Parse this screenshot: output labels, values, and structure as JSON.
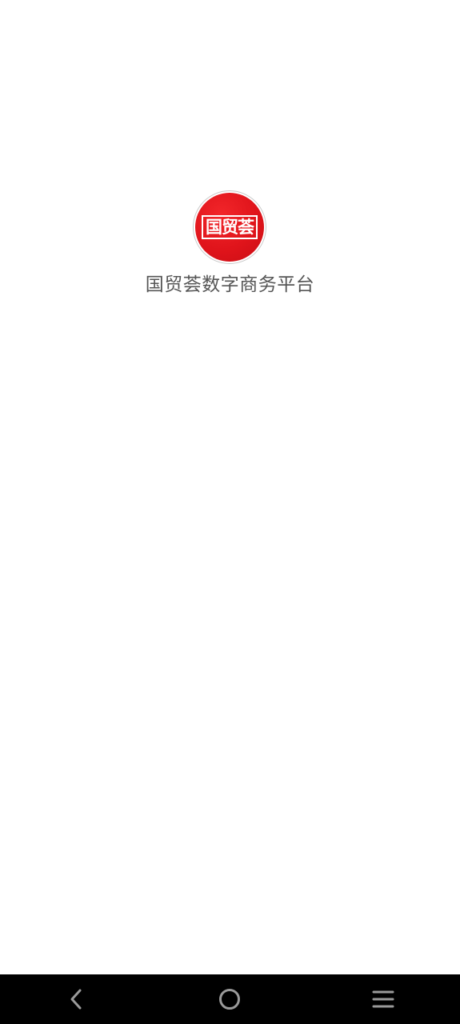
{
  "splash": {
    "logo_text": "国贸荟",
    "app_title": "国贸荟数字商务平台"
  },
  "nav_bar": {
    "back_icon": "back-chevron-icon",
    "home_icon": "home-circle-icon",
    "menu_icon": "menu-lines-icon"
  },
  "colors": {
    "brand_red": "#e0141b",
    "title_gray": "#555555",
    "nav_background": "#000000",
    "nav_icon": "#9a9a9a"
  }
}
